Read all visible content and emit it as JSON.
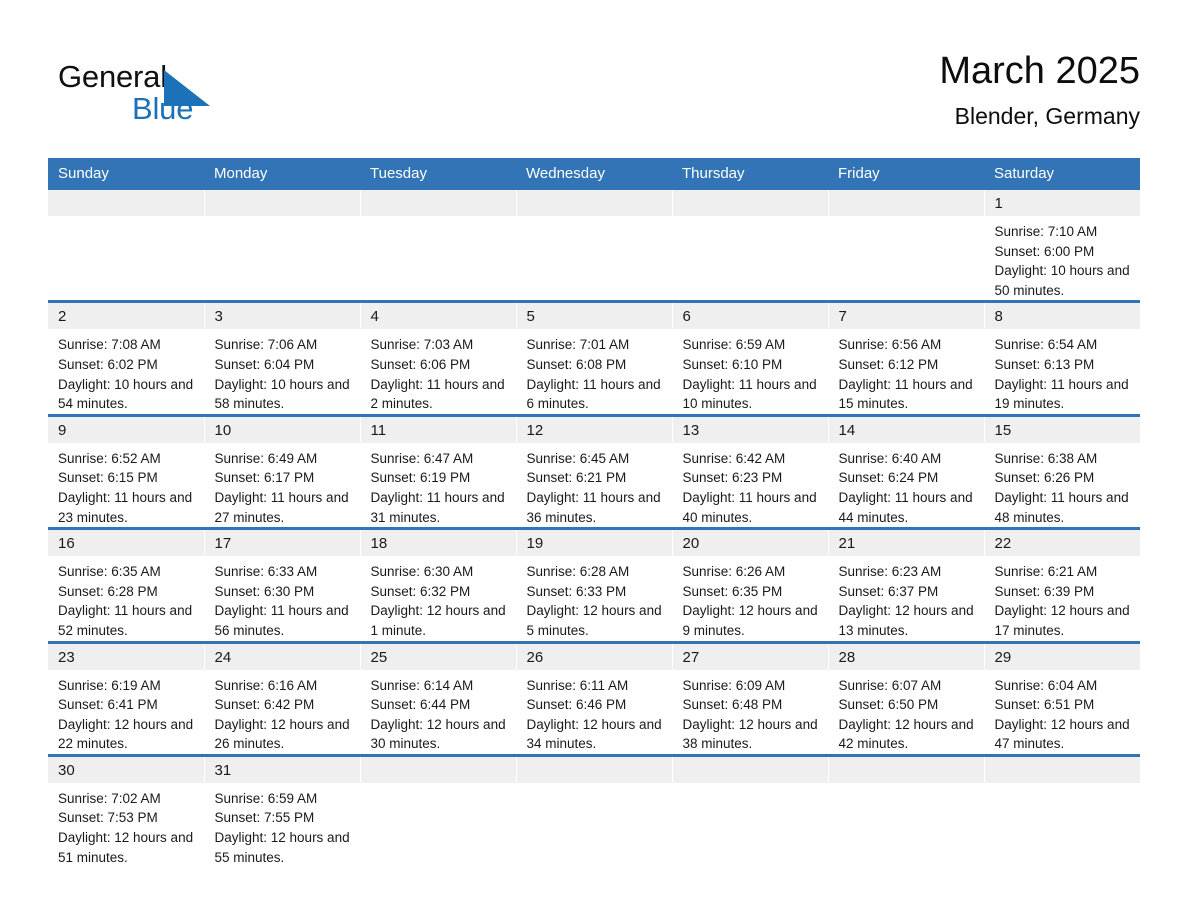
{
  "logo": {
    "word_one": "General",
    "word_two": "Blue",
    "accent_color": "#1b72b8",
    "triangle_icon": "triangle-logo-icon"
  },
  "header": {
    "title": "March 2025",
    "subtitle": "Blender, Germany"
  },
  "theme": {
    "header_blue": "#3274b5",
    "daynum_band": "#efefef",
    "text": "#1a1a1a"
  },
  "calendar": {
    "weekday_headers": [
      "Sunday",
      "Monday",
      "Tuesday",
      "Wednesday",
      "Thursday",
      "Friday",
      "Saturday"
    ],
    "weeks": [
      [
        {
          "day": "",
          "lines": []
        },
        {
          "day": "",
          "lines": []
        },
        {
          "day": "",
          "lines": []
        },
        {
          "day": "",
          "lines": []
        },
        {
          "day": "",
          "lines": []
        },
        {
          "day": "",
          "lines": []
        },
        {
          "day": "1",
          "lines": [
            "Sunrise: 7:10 AM",
            "Sunset: 6:00 PM",
            "Daylight: 10 hours and 50 minutes."
          ]
        }
      ],
      [
        {
          "day": "2",
          "lines": [
            "Sunrise: 7:08 AM",
            "Sunset: 6:02 PM",
            "Daylight: 10 hours and 54 minutes."
          ]
        },
        {
          "day": "3",
          "lines": [
            "Sunrise: 7:06 AM",
            "Sunset: 6:04 PM",
            "Daylight: 10 hours and 58 minutes."
          ]
        },
        {
          "day": "4",
          "lines": [
            "Sunrise: 7:03 AM",
            "Sunset: 6:06 PM",
            "Daylight: 11 hours and 2 minutes."
          ]
        },
        {
          "day": "5",
          "lines": [
            "Sunrise: 7:01 AM",
            "Sunset: 6:08 PM",
            "Daylight: 11 hours and 6 minutes."
          ]
        },
        {
          "day": "6",
          "lines": [
            "Sunrise: 6:59 AM",
            "Sunset: 6:10 PM",
            "Daylight: 11 hours and 10 minutes."
          ]
        },
        {
          "day": "7",
          "lines": [
            "Sunrise: 6:56 AM",
            "Sunset: 6:12 PM",
            "Daylight: 11 hours and 15 minutes."
          ]
        },
        {
          "day": "8",
          "lines": [
            "Sunrise: 6:54 AM",
            "Sunset: 6:13 PM",
            "Daylight: 11 hours and 19 minutes."
          ]
        }
      ],
      [
        {
          "day": "9",
          "lines": [
            "Sunrise: 6:52 AM",
            "Sunset: 6:15 PM",
            "Daylight: 11 hours and 23 minutes."
          ]
        },
        {
          "day": "10",
          "lines": [
            "Sunrise: 6:49 AM",
            "Sunset: 6:17 PM",
            "Daylight: 11 hours and 27 minutes."
          ]
        },
        {
          "day": "11",
          "lines": [
            "Sunrise: 6:47 AM",
            "Sunset: 6:19 PM",
            "Daylight: 11 hours and 31 minutes."
          ]
        },
        {
          "day": "12",
          "lines": [
            "Sunrise: 6:45 AM",
            "Sunset: 6:21 PM",
            "Daylight: 11 hours and 36 minutes."
          ]
        },
        {
          "day": "13",
          "lines": [
            "Sunrise: 6:42 AM",
            "Sunset: 6:23 PM",
            "Daylight: 11 hours and 40 minutes."
          ]
        },
        {
          "day": "14",
          "lines": [
            "Sunrise: 6:40 AM",
            "Sunset: 6:24 PM",
            "Daylight: 11 hours and 44 minutes."
          ]
        },
        {
          "day": "15",
          "lines": [
            "Sunrise: 6:38 AM",
            "Sunset: 6:26 PM",
            "Daylight: 11 hours and 48 minutes."
          ]
        }
      ],
      [
        {
          "day": "16",
          "lines": [
            "Sunrise: 6:35 AM",
            "Sunset: 6:28 PM",
            "Daylight: 11 hours and 52 minutes."
          ]
        },
        {
          "day": "17",
          "lines": [
            "Sunrise: 6:33 AM",
            "Sunset: 6:30 PM",
            "Daylight: 11 hours and 56 minutes."
          ]
        },
        {
          "day": "18",
          "lines": [
            "Sunrise: 6:30 AM",
            "Sunset: 6:32 PM",
            "Daylight: 12 hours and 1 minute."
          ]
        },
        {
          "day": "19",
          "lines": [
            "Sunrise: 6:28 AM",
            "Sunset: 6:33 PM",
            "Daylight: 12 hours and 5 minutes."
          ]
        },
        {
          "day": "20",
          "lines": [
            "Sunrise: 6:26 AM",
            "Sunset: 6:35 PM",
            "Daylight: 12 hours and 9 minutes."
          ]
        },
        {
          "day": "21",
          "lines": [
            "Sunrise: 6:23 AM",
            "Sunset: 6:37 PM",
            "Daylight: 12 hours and 13 minutes."
          ]
        },
        {
          "day": "22",
          "lines": [
            "Sunrise: 6:21 AM",
            "Sunset: 6:39 PM",
            "Daylight: 12 hours and 17 minutes."
          ]
        }
      ],
      [
        {
          "day": "23",
          "lines": [
            "Sunrise: 6:19 AM",
            "Sunset: 6:41 PM",
            "Daylight: 12 hours and 22 minutes."
          ]
        },
        {
          "day": "24",
          "lines": [
            "Sunrise: 6:16 AM",
            "Sunset: 6:42 PM",
            "Daylight: 12 hours and 26 minutes."
          ]
        },
        {
          "day": "25",
          "lines": [
            "Sunrise: 6:14 AM",
            "Sunset: 6:44 PM",
            "Daylight: 12 hours and 30 minutes."
          ]
        },
        {
          "day": "26",
          "lines": [
            "Sunrise: 6:11 AM",
            "Sunset: 6:46 PM",
            "Daylight: 12 hours and 34 minutes."
          ]
        },
        {
          "day": "27",
          "lines": [
            "Sunrise: 6:09 AM",
            "Sunset: 6:48 PM",
            "Daylight: 12 hours and 38 minutes."
          ]
        },
        {
          "day": "28",
          "lines": [
            "Sunrise: 6:07 AM",
            "Sunset: 6:50 PM",
            "Daylight: 12 hours and 42 minutes."
          ]
        },
        {
          "day": "29",
          "lines": [
            "Sunrise: 6:04 AM",
            "Sunset: 6:51 PM",
            "Daylight: 12 hours and 47 minutes."
          ]
        }
      ],
      [
        {
          "day": "30",
          "lines": [
            "Sunrise: 7:02 AM",
            "Sunset: 7:53 PM",
            "Daylight: 12 hours and 51 minutes."
          ]
        },
        {
          "day": "31",
          "lines": [
            "Sunrise: 6:59 AM",
            "Sunset: 7:55 PM",
            "Daylight: 12 hours and 55 minutes."
          ]
        },
        {
          "day": "",
          "lines": []
        },
        {
          "day": "",
          "lines": []
        },
        {
          "day": "",
          "lines": []
        },
        {
          "day": "",
          "lines": []
        },
        {
          "day": "",
          "lines": []
        }
      ]
    ]
  }
}
